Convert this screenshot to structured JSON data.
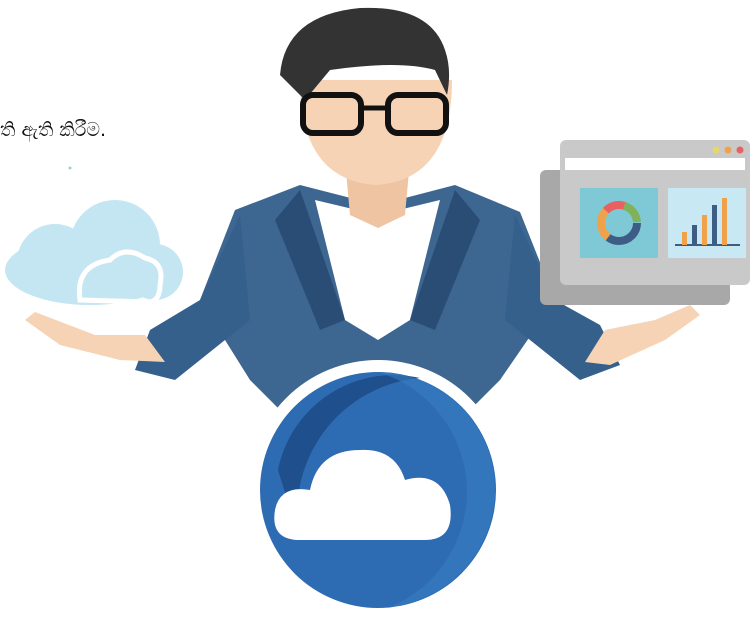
{
  "caption": {
    "text": "ති ඇති කිරීම."
  },
  "illustration": {
    "main_icon": "cloud-icon",
    "left_hand_item": "cloud-icon",
    "right_hand_item": "dashboard-monitor",
    "dashboard_widgets": [
      "donut-chart-icon",
      "bar-chart-icon"
    ],
    "colors": {
      "suit": "#3a5f88",
      "suit_dark": "#27486b",
      "skin": "#f6d3b5",
      "hair": "#2f2f2f",
      "circle_blue": "#2f6fb5",
      "cloud_light": "#bfe3f2",
      "monitor_gray": "#c9c9c9",
      "widget_bg": "#7fc9d6"
    }
  }
}
